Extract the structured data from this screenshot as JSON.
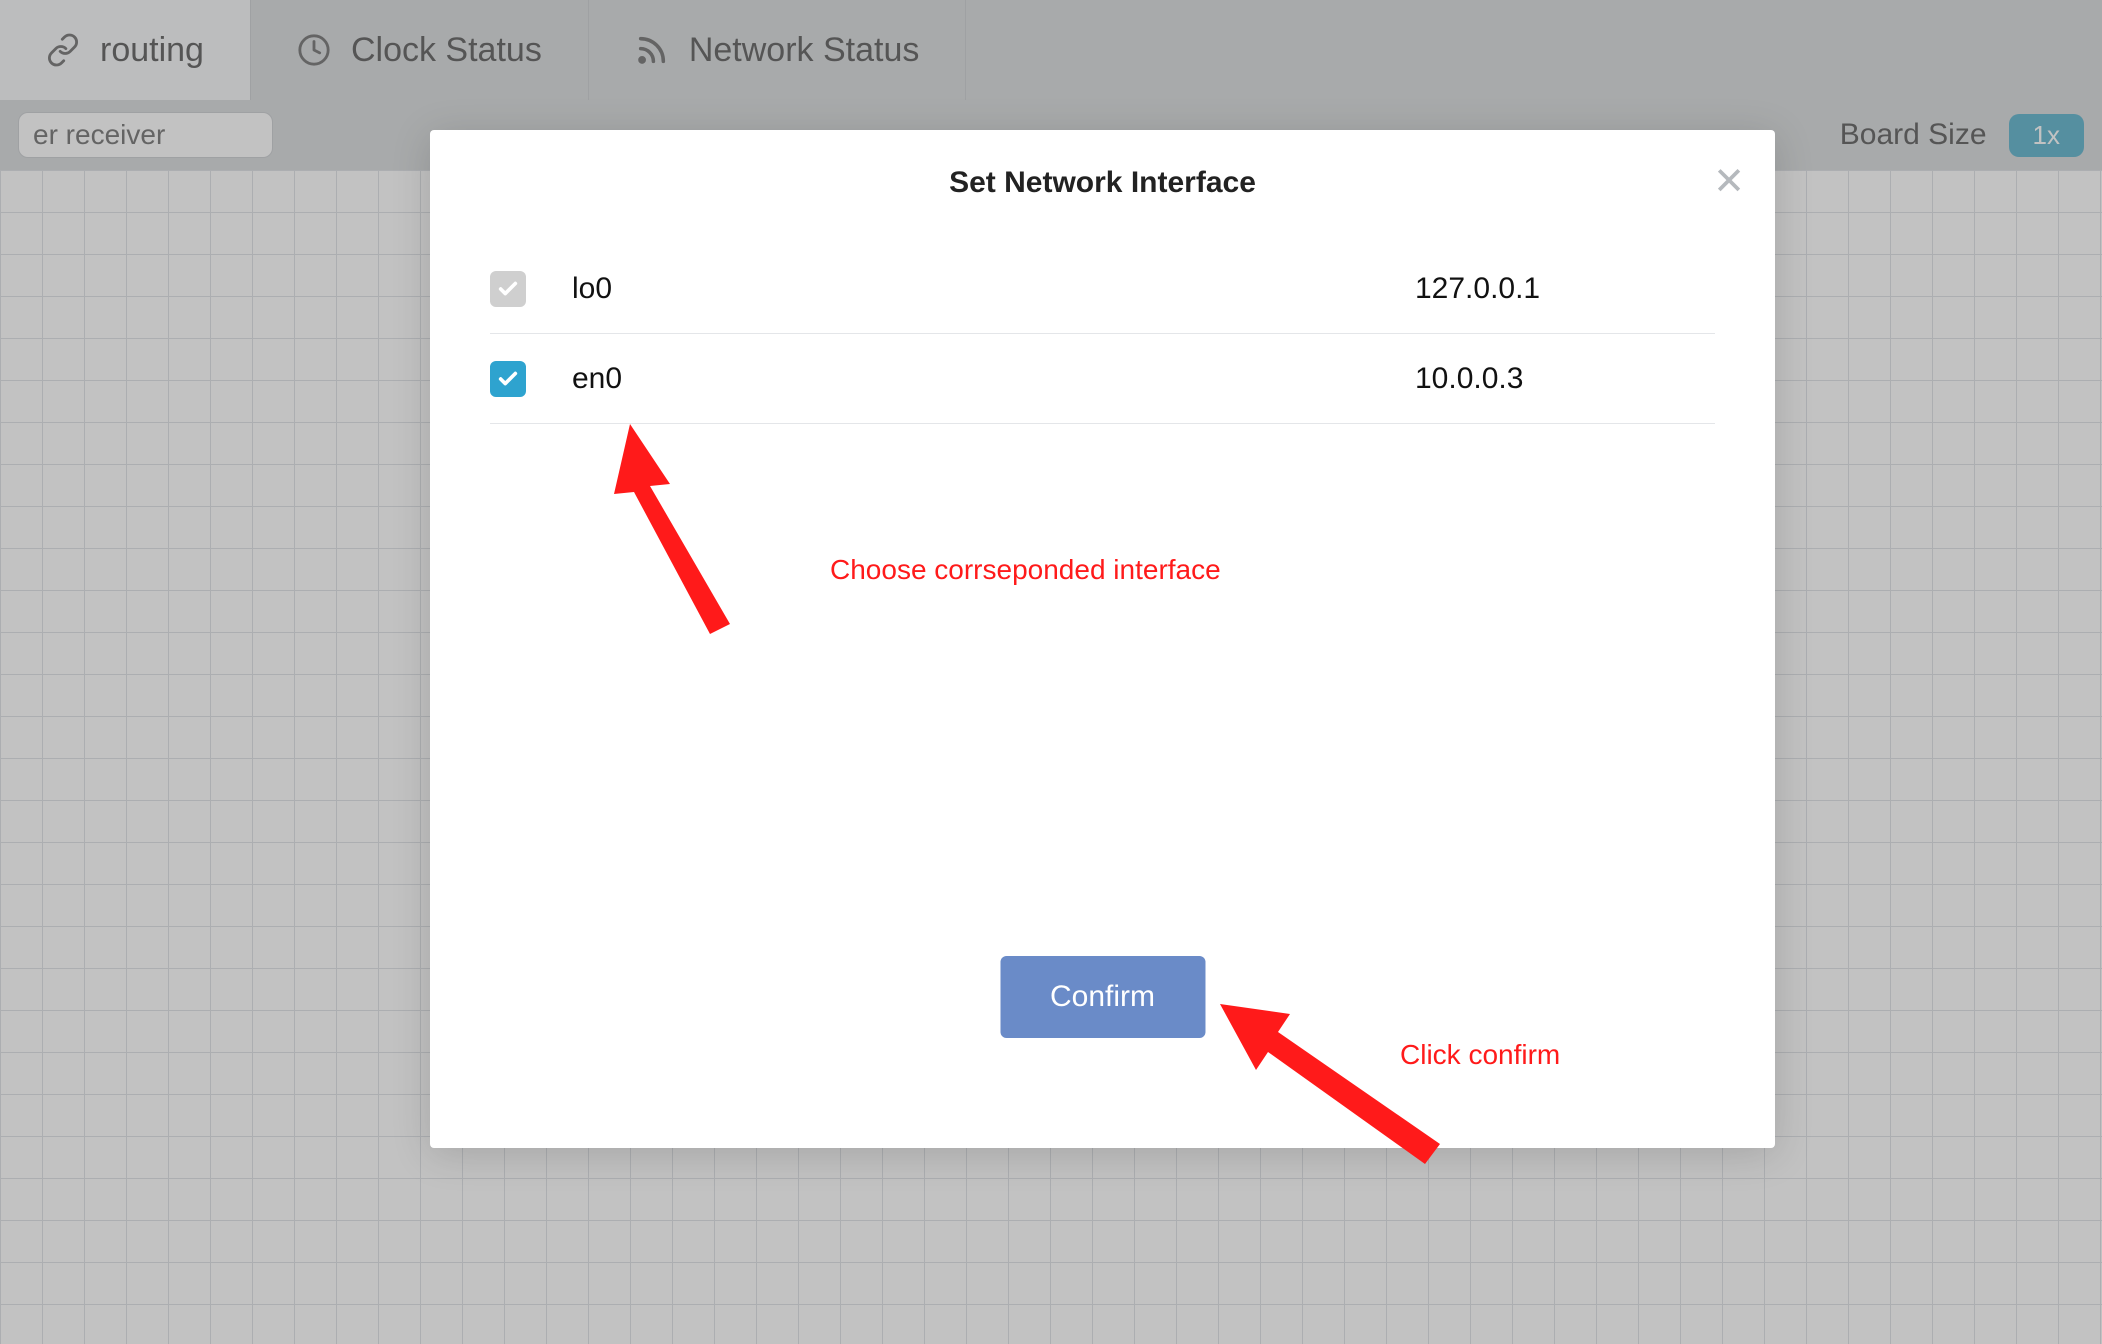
{
  "tabs": {
    "routing": "routing",
    "clock": "Clock Status",
    "network": "Network Status"
  },
  "toolbar": {
    "search_value": "er receiver",
    "board_size_label": "Board Size",
    "zoom_label": "1x"
  },
  "modal": {
    "title": "Set Network Interface",
    "confirm_label": "Confirm",
    "interfaces": [
      {
        "name": "lo0",
        "ip": "127.0.0.1",
        "checked": false
      },
      {
        "name": "en0",
        "ip": "10.0.0.3",
        "checked": true
      }
    ]
  },
  "annotations": {
    "choose": "Choose corrseponded interface",
    "confirm": "Click confirm"
  }
}
